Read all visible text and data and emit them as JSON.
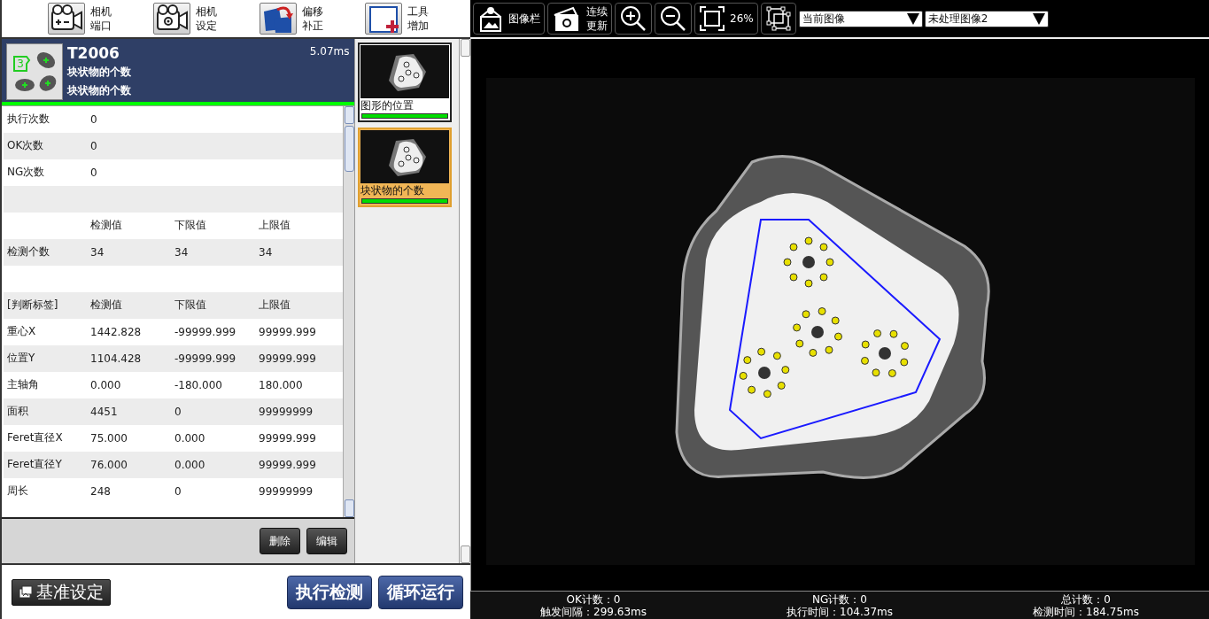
{
  "toolbar": [
    {
      "lines": [
        "相机",
        "端口"
      ]
    },
    {
      "lines": [
        "相机",
        "设定"
      ]
    },
    {
      "lines": [
        "偏移",
        "补正"
      ]
    },
    {
      "lines": [
        "工具",
        "增加"
      ]
    }
  ],
  "tool": {
    "icon_count": "3",
    "id": "T2006",
    "time": "5.07ms",
    "lines": [
      "块状物的个数",
      "块状物的个数"
    ]
  },
  "table": {
    "rows": [
      {
        "kind": "data",
        "label": "执行次数",
        "values": [
          "0"
        ]
      },
      {
        "kind": "data",
        "label": "OK次数",
        "values": [
          "0"
        ]
      },
      {
        "kind": "data",
        "label": "NG次数",
        "values": [
          "0"
        ]
      },
      {
        "kind": "blank"
      },
      {
        "kind": "header",
        "values": [
          "检测值",
          "下限值",
          "上限值"
        ]
      },
      {
        "kind": "data",
        "label": "检测个数",
        "values": [
          "34",
          "34",
          "34"
        ]
      },
      {
        "kind": "blank"
      },
      {
        "kind": "header",
        "label": "[判断标签]",
        "values": [
          "检测值",
          "下限值",
          "上限值"
        ]
      },
      {
        "kind": "data",
        "label": "重心X",
        "values": [
          "1442.828",
          "-99999.999",
          "99999.999"
        ]
      },
      {
        "kind": "data",
        "label": "位置Y",
        "values": [
          "1104.428",
          "-99999.999",
          "99999.999"
        ]
      },
      {
        "kind": "data",
        "label": "主轴角",
        "values": [
          "0.000",
          "-180.000",
          "180.000"
        ]
      },
      {
        "kind": "data",
        "label": "面积",
        "values": [
          "4451",
          "0",
          "99999999"
        ]
      },
      {
        "kind": "data",
        "label": "Feret直径X",
        "values": [
          "75.000",
          "0.000",
          "99999.999"
        ]
      },
      {
        "kind": "data",
        "label": "Feret直径Y",
        "values": [
          "76.000",
          "0.000",
          "99999.999"
        ]
      },
      {
        "kind": "data",
        "label": "周长",
        "values": [
          "248",
          "0",
          "99999999"
        ]
      }
    ]
  },
  "panel_buttons": [
    "删除",
    "编辑"
  ],
  "thumbnails": [
    {
      "label": "图形的位置",
      "selected": false
    },
    {
      "label": "块状物的个数",
      "selected": true
    }
  ],
  "bottom": {
    "reference_button": "基准设定",
    "actions": [
      "执行检测",
      "循环运行"
    ]
  },
  "image_toolbar": {
    "image_bar": "图像栏",
    "continuous_update": [
      "连续",
      "更新"
    ],
    "zoom": "26%",
    "source": "当前图像",
    "image_select": "未处理图像2"
  },
  "status_bar": [
    {
      "label": "OK计数：0"
    },
    {
      "label": "NG计数：0"
    },
    {
      "label": "总计数：0"
    },
    {
      "label": "触发间隔：299.63ms"
    },
    {
      "label": "执行时间：104.37ms"
    },
    {
      "label": "检测时间：184.75ms"
    }
  ]
}
